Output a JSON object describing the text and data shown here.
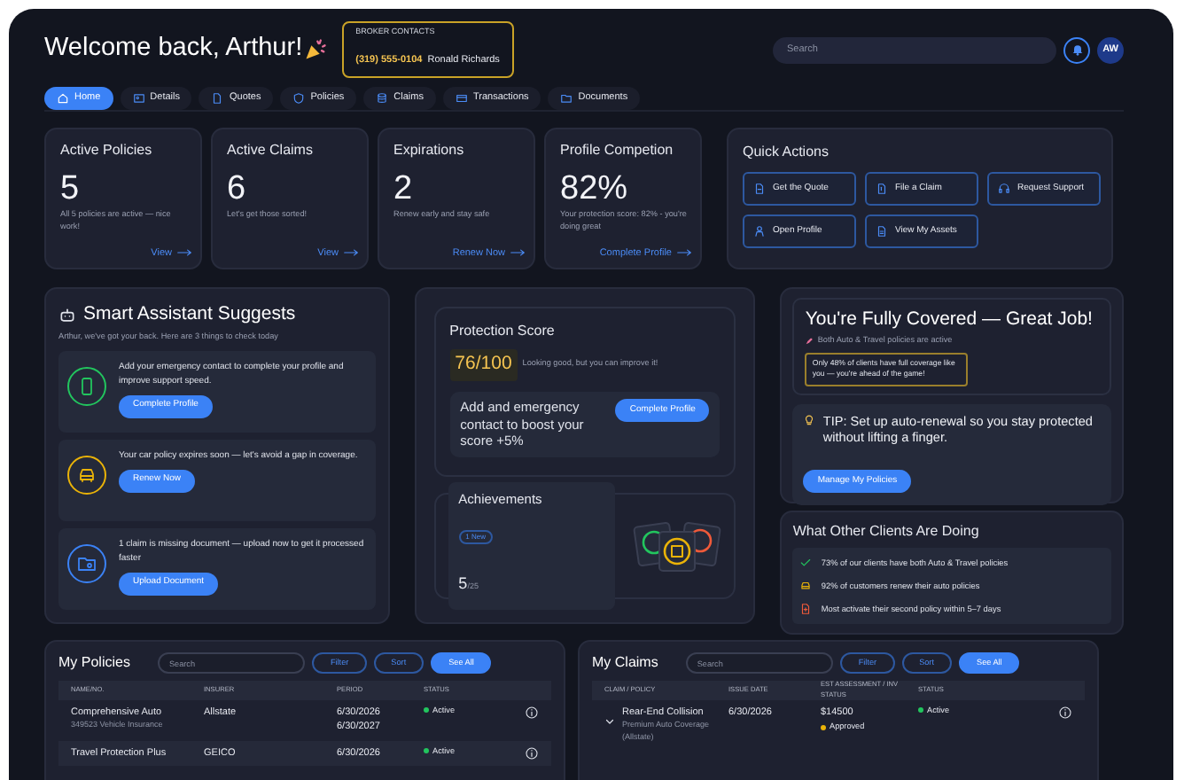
{
  "header": {
    "title": "Welcome back, Arthur!",
    "broker": {
      "label": "BROKER CONTACTS",
      "phone": "(319) 555-0104",
      "name": "Ronald Richards"
    },
    "search": {
      "placeholder": "Search"
    },
    "avatar": "AW"
  },
  "tabs": [
    {
      "label": "Home",
      "selected": true
    },
    {
      "label": "Details",
      "selected": false
    },
    {
      "label": "Quotes",
      "selected": false
    },
    {
      "label": "Policies",
      "selected": false
    },
    {
      "label": "Claims",
      "selected": false
    },
    {
      "label": "Transactions",
      "selected": false
    },
    {
      "label": "Documents",
      "selected": false
    }
  ],
  "stats": [
    {
      "title": "Active Policies",
      "value": "5",
      "note": "All 5 policies are active — nice work!",
      "link": "View"
    },
    {
      "title": "Active Claims",
      "value": "6",
      "note": "Let's get those sorted!",
      "link": "View"
    },
    {
      "title": "Expirations",
      "value": "2",
      "note": "Renew early and stay safe",
      "link": "Renew Now"
    },
    {
      "title": "Profile Competion",
      "value": "82%",
      "note": "Your protection score: 82% - you're doing great",
      "link": "Complete Profile"
    }
  ],
  "quick_actions": {
    "title": "Quick Actions",
    "buttons": [
      "Get the Quote",
      "File a Claim",
      "Request Support",
      "Open Profile",
      "View My Assets"
    ]
  },
  "assistant": {
    "title": "Smart Assistant Suggests",
    "subtitle": "Arthur, we've got your back. Here are 3 things to check today",
    "items": [
      {
        "text": "Add your emergency contact to complete your profile and improve support speed.",
        "button": "Complete Profile",
        "color": "#22c55e"
      },
      {
        "text": "Your car policy expires soon — let's avoid a gap in coverage.",
        "button": "Renew Now",
        "color": "#eab308"
      },
      {
        "text": "1 claim is missing document — upload now to get it processed faster",
        "button": "Upload Document",
        "color": "#3b82f6"
      }
    ]
  },
  "protection": {
    "title": "Protection Score",
    "score": "76/100",
    "note": "Looking good, but you can improve it!",
    "cta_text": "Add and emergency contact to boost your score +5%",
    "cta_button": "Complete Profile",
    "achievements": {
      "title": "Achievements",
      "badge": "1 New",
      "count": "5",
      "total": "/25"
    }
  },
  "covered": {
    "title": "You're Fully Covered — Great Job!",
    "note": "Both Auto & Travel policies are active",
    "callout": "Only 48% of clients have full coverage like you — you're ahead of the game!",
    "tip": "TIP: Set up auto-renewal so you stay protected without lifting a finger.",
    "tip_button": "Manage My Policies"
  },
  "others": {
    "title": "What Other Clients Are Doing",
    "items": [
      "73% of our clients have both Auto & Travel policies",
      "92% of customers renew their auto policies",
      "Most activate their second policy within 5–7 days"
    ]
  },
  "policies": {
    "title": "My Policies",
    "search_placeholder": "Search",
    "buttons": [
      "Filter",
      "Sort",
      "See All"
    ],
    "columns": [
      "NAME/NO.",
      "INSURER",
      "PERIOD",
      "STATUS"
    ],
    "rows": [
      {
        "name": "Comprehensive Auto",
        "sub": "349523 Vehicle Insurance",
        "insurer": "Allstate",
        "period": [
          "6/30/2026",
          "6/30/2027"
        ],
        "status": {
          "text": "Active",
          "color": "#22c55e"
        }
      },
      {
        "name": "Travel Protection Plus",
        "sub": "",
        "insurer": "GEICO",
        "period": [
          "6/30/2026"
        ],
        "status": {
          "text": "Active",
          "color": "#22c55e"
        }
      }
    ]
  },
  "claims": {
    "title": "My Claims",
    "search_placeholder": "Search",
    "buttons": [
      "Filter",
      "Sort",
      "See All"
    ],
    "columns": [
      "CLAIM / POLICY",
      "ISSUE DATE",
      "EST ASSESSMENT / INV STATUS",
      "STATUS"
    ],
    "rows": [
      {
        "title": "Rear-End Collision",
        "sub": "Premium Auto Coverage (Allstate)",
        "date": "6/30/2026",
        "amount": "$14500",
        "inv_status": {
          "text": "Approved",
          "color": "#eab308"
        },
        "status": {
          "text": "Active",
          "color": "#22c55e"
        }
      }
    ]
  }
}
